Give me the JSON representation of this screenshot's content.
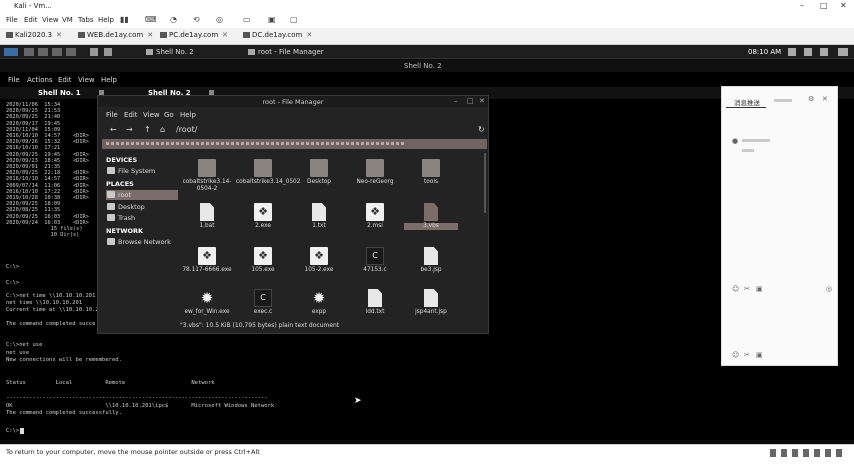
{
  "host": {
    "title": "Kali - Vm...",
    "menu": [
      "File",
      "Edit",
      "View",
      "VM",
      "Tabs",
      "Help"
    ],
    "tabs": [
      {
        "label": "Kali2020.3"
      },
      {
        "label": "WEB.de1ay.com"
      },
      {
        "label": "PC.de1ay.com"
      },
      {
        "label": "DC.de1ay.com"
      }
    ],
    "hint": "To return to your computer, move the mouse pointer outside or press Ctrl+Alt"
  },
  "kali_panel": {
    "tabs": [
      "Shell No. 2",
      "root - File Manager"
    ],
    "clock": "08:10 AM"
  },
  "terminal": {
    "title": "Shell No. 2",
    "menu": [
      "File",
      "Actions",
      "Edit",
      "View",
      "Help"
    ],
    "tabs": [
      "Shell No. 1",
      "Shell No. 2"
    ],
    "dir_lines": "2020/11/06  15:34\n2020/09/25  21:53\n2020/09/25  21:40\n2020/09/17  19:45\n2020/11/04  15:09\n2016/10/10  14:57    <DIR>\n2020/09/26  15:32    <DIR>\n2016/10/10  17:21\n2020/09/25  19:45    <DIR>\n2020/09/23  18:45    <DIR>\n2020/09/01  21:35\n2020/09/25  22:18    <DIR>\n2016/10/10  14:57    <DIR>\n2009/07/14  11:06    <DIR>\n2016/10/10  17:22    <DIR>\n2019/10/28  10:38    <DIR>\n2020/09/25  18:09\n2020/08/25  11:35\n2020/09/25  16:03    <DIR>\n2020/09/24  16:03    <DIR>\n              15 file(s)\n              10 Dir(s)",
    "prompt1": "C:\\>",
    "prompt2": "C:\\>",
    "net_time_block": "C:\\>net time \\\\10.10.10.201\nnet time \\\\10.10.10.201\nCurrent time at \\\\10.10.10.201\n\nThe command completed succe",
    "net_use_block": "C:\\>net use\nnet use\nNew connections will be remembered.\n\n\nStatus         Local          Remote                    Network\n\n-------------------------------------------------------------------------------\nOK                            \\\\10.10.10.201\\ipc$       Microsoft Windows Network\nThe command completed successfully.",
    "prompt3": "C:\\>"
  },
  "file_manager": {
    "title": "root - File Manager",
    "menu": [
      "File",
      "Edit",
      "View",
      "Go",
      "Help"
    ],
    "path": "/root/",
    "sections": [
      {
        "header": "DEVICES",
        "items": [
          {
            "label": "File System",
            "icon": "harddisk-icon"
          }
        ]
      },
      {
        "header": "PLACES",
        "items": [
          {
            "label": "root",
            "icon": "home-folder-icon",
            "selected": true
          },
          {
            "label": "Desktop",
            "icon": "desktop-folder-icon"
          },
          {
            "label": "Trash",
            "icon": "trash-icon"
          }
        ]
      },
      {
        "header": "NETWORK",
        "items": [
          {
            "label": "Browse Network",
            "icon": "network-icon"
          }
        ]
      }
    ],
    "files": [
      {
        "name": "cobaltstrike3.14-0504-2",
        "kind": "folder"
      },
      {
        "name": "cobaltstrike3.14_0502",
        "kind": "folder"
      },
      {
        "name": "Desktop",
        "kind": "folder"
      },
      {
        "name": "Neo-reGeorg",
        "kind": "folder"
      },
      {
        "name": "tools",
        "kind": "folder"
      },
      {
        "name": "1.bat",
        "kind": "doc"
      },
      {
        "name": "2.exe",
        "kind": "exe"
      },
      {
        "name": "1.txt",
        "kind": "doc"
      },
      {
        "name": "2.msi",
        "kind": "exe"
      },
      {
        "name": "3.vbs",
        "kind": "doc",
        "selected": true
      },
      {
        "name": "78.117-6666.exe",
        "kind": "exe"
      },
      {
        "name": "105.exe",
        "kind": "exe"
      },
      {
        "name": "105-2.exe",
        "kind": "exe"
      },
      {
        "name": "47153.c",
        "kind": "code"
      },
      {
        "name": "be3.jsp",
        "kind": "doc"
      },
      {
        "name": "ew_for_Win.exe",
        "kind": "gear"
      },
      {
        "name": "exec.c",
        "kind": "code"
      },
      {
        "name": "expp",
        "kind": "gear"
      },
      {
        "name": "ldd.txt",
        "kind": "doc"
      },
      {
        "name": "jsp4ant.jsp",
        "kind": "doc"
      }
    ],
    "status": "\"3.vbs\": 10.5 KiB (10,795 bytes) plain text document"
  },
  "chat_panel": {
    "tab": "消息推送"
  }
}
